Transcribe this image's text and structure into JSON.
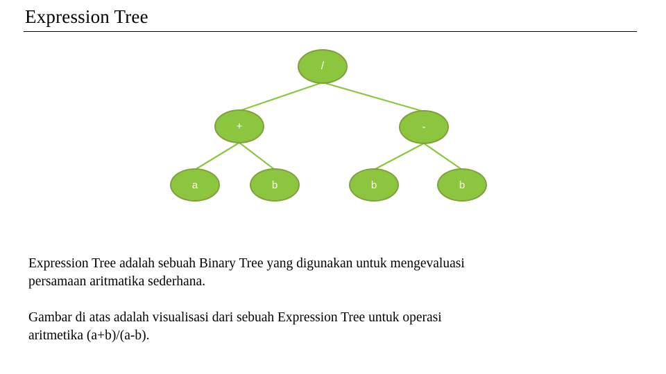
{
  "slide": {
    "title": "Expression Tree",
    "background_color": "#FFFFFF",
    "rule_color": "#000000"
  },
  "diagram": {
    "name": "expression-tree-diagram",
    "node_fill": "#8CC63E",
    "node_border": "#7FA03C",
    "node_text_color": "#FFFFFF",
    "edge_color": "#8CC63E",
    "nodes": {
      "root": "/",
      "op_left": "+",
      "op_right": "-",
      "leaf_1": "a",
      "leaf_2": "b",
      "leaf_3": "b",
      "leaf_4": "b"
    }
  },
  "body": {
    "paragraph_1": "Expression Tree adalah sebuah Binary Tree yang digunakan untuk mengevaluasi",
    "paragraph_1_last": "persamaan aritmatika sederhana.",
    "paragraph_2": "Gambar di atas adalah visualisasi dari sebuah Expression Tree untuk operasi",
    "paragraph_2_last": "aritmetika (a+b)/(a-b)."
  }
}
